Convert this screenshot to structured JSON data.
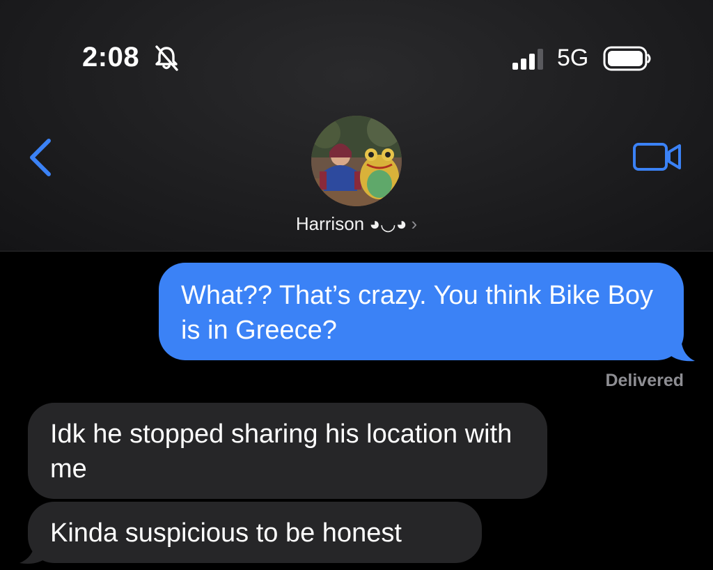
{
  "status_bar": {
    "time": "2:08",
    "network": "5G",
    "icons": [
      "bell-slash-icon",
      "signal-icon",
      "battery-icon"
    ]
  },
  "header": {
    "contact_name": "Harrison ◕◡◕",
    "back_icon": "chevron-left-icon",
    "video_icon": "video-camera-icon",
    "chevron": "›"
  },
  "messages": [
    {
      "direction": "outgoing",
      "text": "What?? That’s crazy. You think Bike Boy is in Greece?"
    },
    {
      "direction": "incoming",
      "text": "Idk he stopped sharing his location with me"
    },
    {
      "direction": "incoming",
      "text": "Kinda suspicious to be honest"
    }
  ],
  "delivered_label": "Delivered",
  "colors": {
    "accent": "#3b82f6",
    "incoming_bubble": "#262628",
    "secondary_text": "#8e8e93"
  }
}
